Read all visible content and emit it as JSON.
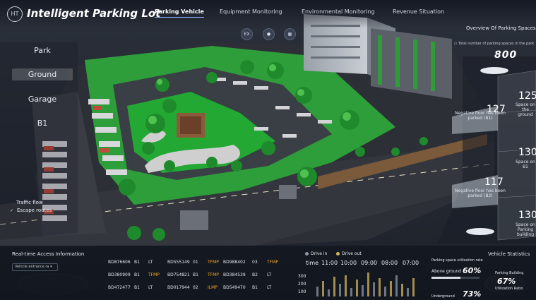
{
  "header": {
    "logo": "HT",
    "title_part1": "Intelligent ",
    "title_part2": "Parking",
    "title_part3": " Lot",
    "tabs": [
      {
        "label": "Parking Vehicle",
        "active": true
      },
      {
        "label": "Equipment Monitoring",
        "active": false
      },
      {
        "label": "Environmental Monitoring",
        "active": false
      },
      {
        "label": "Revenue Situation",
        "active": false
      }
    ]
  },
  "toolbar": {
    "buttons": [
      "EX",
      "",
      ""
    ]
  },
  "layers": {
    "items": [
      "Park",
      "Ground",
      "Garage",
      "B1"
    ],
    "selected": "Ground"
  },
  "options": {
    "traffic_flow": "Traffic flow",
    "escape_routes": "Escape routes",
    "escape_checked": true
  },
  "overview": {
    "title": "Overview Of Parking Spaces",
    "total_label": "Total number of parking spaces in the park",
    "total_value": "800",
    "stats": [
      {
        "num": "125",
        "label": "Space on the ground"
      },
      {
        "num": "127",
        "label": "Negative floor has been parked (B1)"
      },
      {
        "num": "130",
        "label": "Space on B1"
      },
      {
        "num": "117",
        "label": "Negative floor has been parked (B2)"
      },
      {
        "num": "130",
        "label": "Space on Parking building"
      }
    ]
  },
  "access": {
    "title": "Real-time Access Information",
    "dropdown": "Vehicle entrance ra",
    "rows": [
      [
        {
          "plate": "BD876606",
          "loc": "B1",
          "type": "LT",
          "warn": false
        },
        {
          "plate": "BD555149",
          "loc": "01",
          "type": "TFMP",
          "warn": true
        },
        {
          "plate": "BD988402",
          "loc": "03",
          "type": "TFMP",
          "warn": true
        }
      ],
      [
        {
          "plate": "BD380909",
          "loc": "B1",
          "type": "TFMP",
          "warn": true
        },
        {
          "plate": "BD754821",
          "loc": "B1",
          "type": "TFMP",
          "warn": true
        },
        {
          "plate": "BD384539",
          "loc": "B2",
          "type": "LT",
          "warn": false
        }
      ],
      [
        {
          "plate": "BD472477",
          "loc": "B1",
          "type": "LT",
          "warn": false
        },
        {
          "plate": "BD017944",
          "loc": "02",
          "type": "ILMP",
          "warn": true
        },
        {
          "plate": "BD549470",
          "loc": "B1",
          "type": "LT",
          "warn": false
        }
      ]
    ]
  },
  "flow": {
    "legend_in": "Drive in",
    "legend_out": "Drive out",
    "time_label": "time",
    "times": [
      "11:00",
      "10:00",
      "09:00",
      "08:00",
      "07:00"
    ],
    "yticks": [
      "300",
      "200",
      "100"
    ]
  },
  "utilization": {
    "title": "Parking space utilization rate",
    "above_label": "Above ground",
    "above_value": "60%",
    "above_pct": 60,
    "under_label": "Underground",
    "under_value": "73%",
    "under_pct": 73
  },
  "vehicle_stats": {
    "title": "Vehicle Statistics",
    "building": "Parking Building",
    "value": "67%",
    "sub": "Utilization Ratio"
  },
  "colors": {
    "accent": "#8fb3ff",
    "warn": "#f5a623",
    "drive_in": "#8f97a8",
    "drive_out": "#d4b55e"
  }
}
